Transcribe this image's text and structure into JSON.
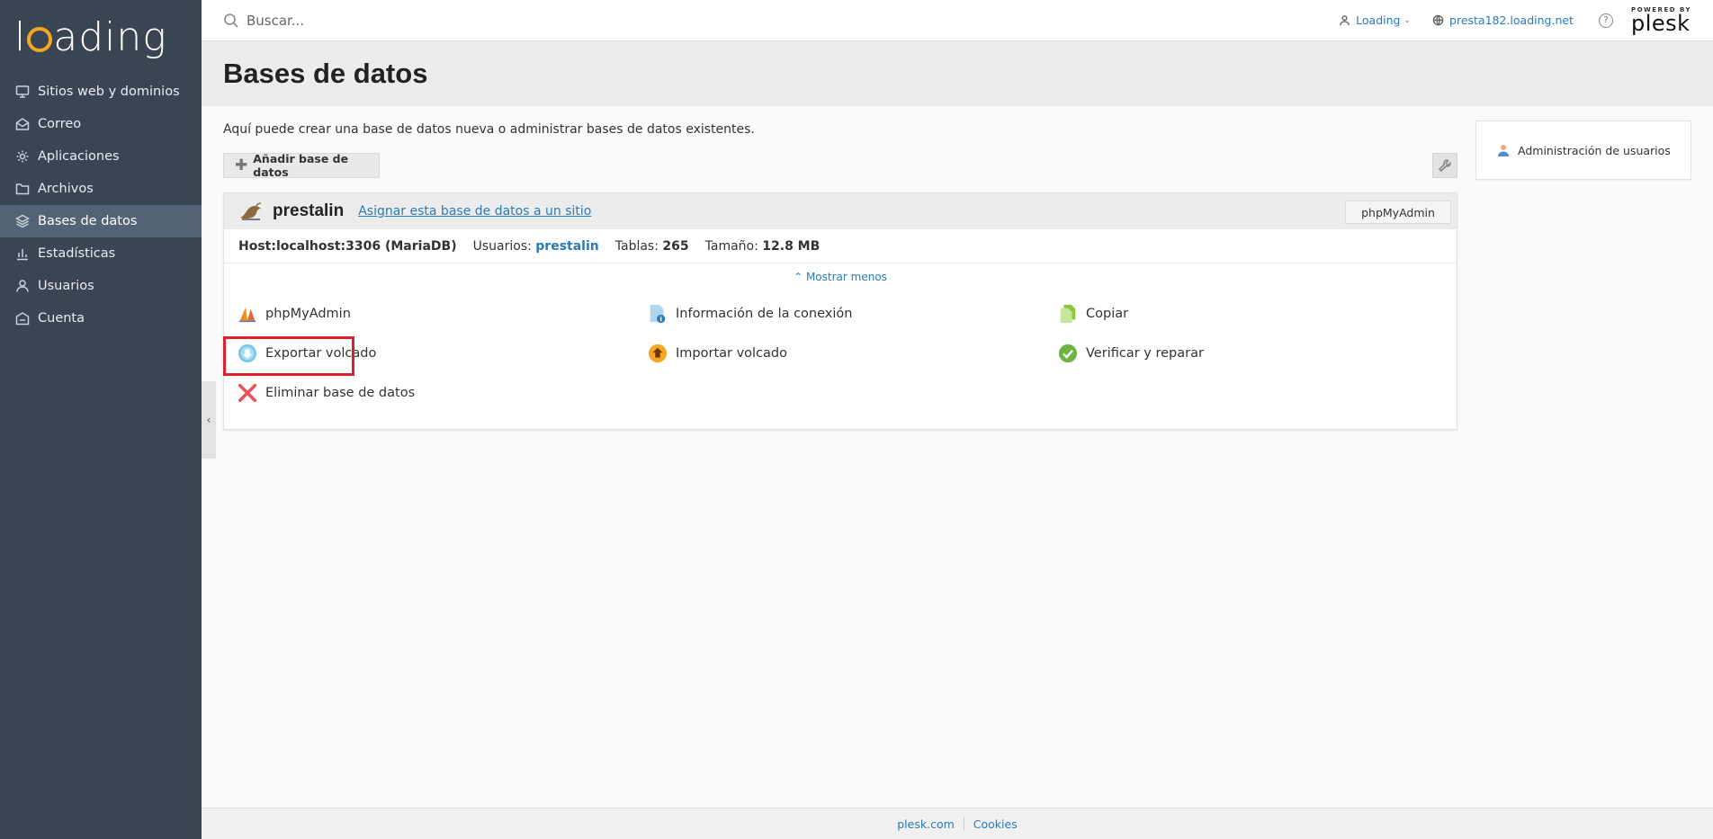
{
  "brand": {
    "logo_pre": "l",
    "logo_post": "ading",
    "logo_alt": "loading"
  },
  "sidebar": {
    "items": [
      {
        "label": "Sitios web y dominios",
        "icon": "monitor-icon"
      },
      {
        "label": "Correo",
        "icon": "mail-icon"
      },
      {
        "label": "Aplicaciones",
        "icon": "gear-icon"
      },
      {
        "label": "Archivos",
        "icon": "folder-icon"
      },
      {
        "label": "Bases de datos",
        "icon": "layers-icon",
        "active": true
      },
      {
        "label": "Estadísticas",
        "icon": "bar-chart-icon"
      },
      {
        "label": "Usuarios",
        "icon": "user-icon"
      },
      {
        "label": "Cuenta",
        "icon": "account-icon"
      }
    ]
  },
  "topbar": {
    "search_placeholder": "Buscar...",
    "user_label": "Loading",
    "domain_label": "presta182.loading.net",
    "help_label": "?",
    "powered_by": "POWERED BY",
    "plesk": "plesk"
  },
  "page": {
    "title": "Bases de datos",
    "description": "Aquí puede crear una base de datos nueva o administrar bases de datos existentes.",
    "add_button": "Añadir base de datos"
  },
  "database": {
    "name": "prestalin",
    "assign_link": "Asignar esta base de datos a un sitio",
    "phpmyadmin_button": "phpMyAdmin",
    "host_label": "Host:",
    "host_value": "localhost:3306 (MariaDB)",
    "users_label": "Usuarios:",
    "users_value": "prestalin",
    "tables_label": "Tablas:",
    "tables_value": "265",
    "size_label": "Tamaño:",
    "size_value": "12.8 MB",
    "toggle_label": "Mostrar menos",
    "actions": {
      "phpmyadmin": "phpMyAdmin",
      "connection_info": "Información de la conexión",
      "copy": "Copiar",
      "export_dump": "Exportar volcado",
      "import_dump": "Importar volcado",
      "check_repair": "Verificar y reparar",
      "delete": "Eliminar base de datos"
    }
  },
  "side_panel": {
    "user_admin": "Administración de usuarios"
  },
  "footer": {
    "link1": "plesk.com",
    "link2": "Cookies"
  },
  "colors": {
    "sidebar_bg": "#3a4553",
    "active_bg": "#536274",
    "link": "#2b7bb9",
    "highlight": "#e0202a"
  }
}
